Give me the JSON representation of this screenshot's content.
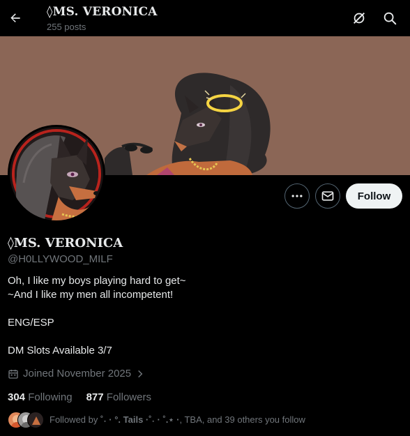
{
  "header": {
    "title": "◊MS. VERONICA",
    "posts_count": "255 posts",
    "back_icon": "arrow-left-icon",
    "grok_icon": "grok-icon",
    "search_icon": "search-icon"
  },
  "profile": {
    "display_name": "◊MS. VERONICA",
    "handle": "@H0LLYWOOD_MILF",
    "bio_lines": [
      "Oh, I like my boys playing hard to get~",
      "~And I like my men all incompetent!",
      "",
      "ENG/ESP",
      "",
      "DM Slots Available 3/7"
    ],
    "joined": "Joined November 2025",
    "following_count": "304",
    "following_label": "Following",
    "followers_count": "877",
    "followers_label": "Followers",
    "followed_by_prefix": "Followed by",
    "followed_by_name": "˚˖ · °. Tails ·˚˖ · ˚.⋆ ·",
    "followed_by_suffix": ", TBA, and 39 others you follow"
  },
  "actions": {
    "follow_label": "Follow",
    "more_icon": "more-icon",
    "message_icon": "envelope-icon"
  },
  "colors": {
    "background": "#000000",
    "banner": "#8b6656",
    "text_primary": "#e7e9ea",
    "text_secondary": "#71767b",
    "follow_bg": "#eff3f4",
    "halo": "#f5d442"
  }
}
